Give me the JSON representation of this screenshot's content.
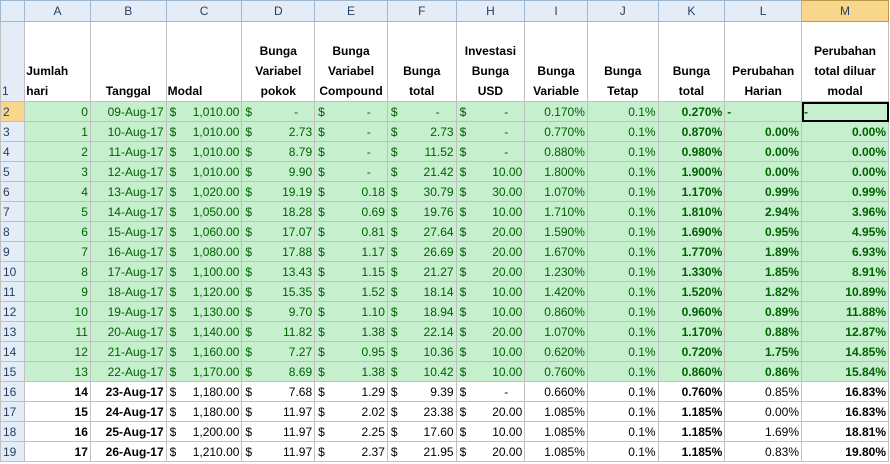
{
  "columns": [
    "A",
    "B",
    "C",
    "D",
    "E",
    "F",
    "H",
    "I",
    "J",
    "K",
    "L",
    "M"
  ],
  "selected_column": "M",
  "headers": [
    "Jumlah hari",
    "Tanggal",
    "Modal",
    "Bunga Variabel pokok",
    "Bunga Variabel Compound",
    "Bunga total",
    "Investasi Bunga USD",
    "Bunga Variable",
    "Bunga Tetap",
    "Bunga total",
    "Perubahan Harian",
    "Perubahan total diluar modal"
  ],
  "rows": [
    {
      "num": "2",
      "style": "green",
      "bold": false,
      "cells": [
        "0",
        "09-Aug-17",
        "1,010.00",
        "-",
        "-",
        "-",
        "-",
        "0.170%",
        "0.1%",
        "0.270%",
        "-",
        "-"
      ]
    },
    {
      "num": "3",
      "style": "green",
      "bold": false,
      "cells": [
        "1",
        "10-Aug-17",
        "1,010.00",
        "2.73",
        "-",
        "2.73",
        "-",
        "0.770%",
        "0.1%",
        "0.870%",
        "0.00%",
        "0.00%"
      ]
    },
    {
      "num": "4",
      "style": "green",
      "bold": false,
      "cells": [
        "2",
        "11-Aug-17",
        "1,010.00",
        "8.79",
        "-",
        "11.52",
        "-",
        "0.880%",
        "0.1%",
        "0.980%",
        "0.00%",
        "0.00%"
      ]
    },
    {
      "num": "5",
      "style": "green",
      "bold": false,
      "cells": [
        "3",
        "12-Aug-17",
        "1,010.00",
        "9.90",
        "-",
        "21.42",
        "10.00",
        "1.800%",
        "0.1%",
        "1.900%",
        "0.00%",
        "0.00%"
      ]
    },
    {
      "num": "6",
      "style": "green",
      "bold": false,
      "cells": [
        "4",
        "13-Aug-17",
        "1,020.00",
        "19.19",
        "0.18",
        "30.79",
        "30.00",
        "1.070%",
        "0.1%",
        "1.170%",
        "0.99%",
        "0.99%"
      ]
    },
    {
      "num": "7",
      "style": "green",
      "bold": false,
      "cells": [
        "5",
        "14-Aug-17",
        "1,050.00",
        "18.28",
        "0.69",
        "19.76",
        "10.00",
        "1.710%",
        "0.1%",
        "1.810%",
        "2.94%",
        "3.96%"
      ]
    },
    {
      "num": "8",
      "style": "green",
      "bold": false,
      "cells": [
        "6",
        "15-Aug-17",
        "1,060.00",
        "17.07",
        "0.81",
        "27.64",
        "20.00",
        "1.590%",
        "0.1%",
        "1.690%",
        "0.95%",
        "4.95%"
      ]
    },
    {
      "num": "9",
      "style": "green",
      "bold": false,
      "cells": [
        "7",
        "16-Aug-17",
        "1,080.00",
        "17.88",
        "1.17",
        "26.69",
        "20.00",
        "1.670%",
        "0.1%",
        "1.770%",
        "1.89%",
        "6.93%"
      ]
    },
    {
      "num": "10",
      "style": "green",
      "bold": false,
      "cells": [
        "8",
        "17-Aug-17",
        "1,100.00",
        "13.43",
        "1.15",
        "21.27",
        "20.00",
        "1.230%",
        "0.1%",
        "1.330%",
        "1.85%",
        "8.91%"
      ]
    },
    {
      "num": "11",
      "style": "green",
      "bold": false,
      "cells": [
        "9",
        "18-Aug-17",
        "1,120.00",
        "15.35",
        "1.52",
        "18.14",
        "10.00",
        "1.420%",
        "0.1%",
        "1.520%",
        "1.82%",
        "10.89%"
      ]
    },
    {
      "num": "12",
      "style": "green",
      "bold": false,
      "cells": [
        "10",
        "19-Aug-17",
        "1,130.00",
        "9.70",
        "1.10",
        "18.94",
        "10.00",
        "0.860%",
        "0.1%",
        "0.960%",
        "0.89%",
        "11.88%"
      ]
    },
    {
      "num": "13",
      "style": "green",
      "bold": false,
      "cells": [
        "11",
        "20-Aug-17",
        "1,140.00",
        "11.82",
        "1.38",
        "22.14",
        "20.00",
        "1.070%",
        "0.1%",
        "1.170%",
        "0.88%",
        "12.87%"
      ]
    },
    {
      "num": "14",
      "style": "green",
      "bold": false,
      "cells": [
        "12",
        "21-Aug-17",
        "1,160.00",
        "7.27",
        "0.95",
        "10.36",
        "10.00",
        "0.620%",
        "0.1%",
        "0.720%",
        "1.75%",
        "14.85%"
      ]
    },
    {
      "num": "15",
      "style": "green",
      "bold": false,
      "cells": [
        "13",
        "22-Aug-17",
        "1,170.00",
        "8.69",
        "1.38",
        "10.42",
        "10.00",
        "0.760%",
        "0.1%",
        "0.860%",
        "0.86%",
        "15.84%"
      ]
    },
    {
      "num": "16",
      "style": "white",
      "bold": true,
      "cells": [
        "14",
        "23-Aug-17",
        "1,180.00",
        "7.68",
        "1.29",
        "9.39",
        "-",
        "0.660%",
        "0.1%",
        "0.760%",
        "0.85%",
        "16.83%"
      ]
    },
    {
      "num": "17",
      "style": "white",
      "bold": true,
      "cells": [
        "15",
        "24-Aug-17",
        "1,180.00",
        "11.97",
        "2.02",
        "23.38",
        "20.00",
        "1.085%",
        "0.1%",
        "1.185%",
        "0.00%",
        "16.83%"
      ]
    },
    {
      "num": "18",
      "style": "white",
      "bold": true,
      "cells": [
        "16",
        "25-Aug-17",
        "1,200.00",
        "11.97",
        "2.25",
        "17.60",
        "10.00",
        "1.085%",
        "0.1%",
        "1.185%",
        "1.69%",
        "18.81%"
      ]
    },
    {
      "num": "19",
      "style": "white",
      "bold": true,
      "cells": [
        "17",
        "26-Aug-17",
        "1,210.00",
        "11.97",
        "2.37",
        "21.95",
        "20.00",
        "1.085%",
        "0.1%",
        "1.185%",
        "0.83%",
        "19.80%"
      ]
    }
  ],
  "currency_symbol": "$",
  "colors": {
    "green_fill": "#c5efcd",
    "green_text": "#006100",
    "header_fill": "#e4ecf7",
    "selected_header": "#f8d68c"
  }
}
